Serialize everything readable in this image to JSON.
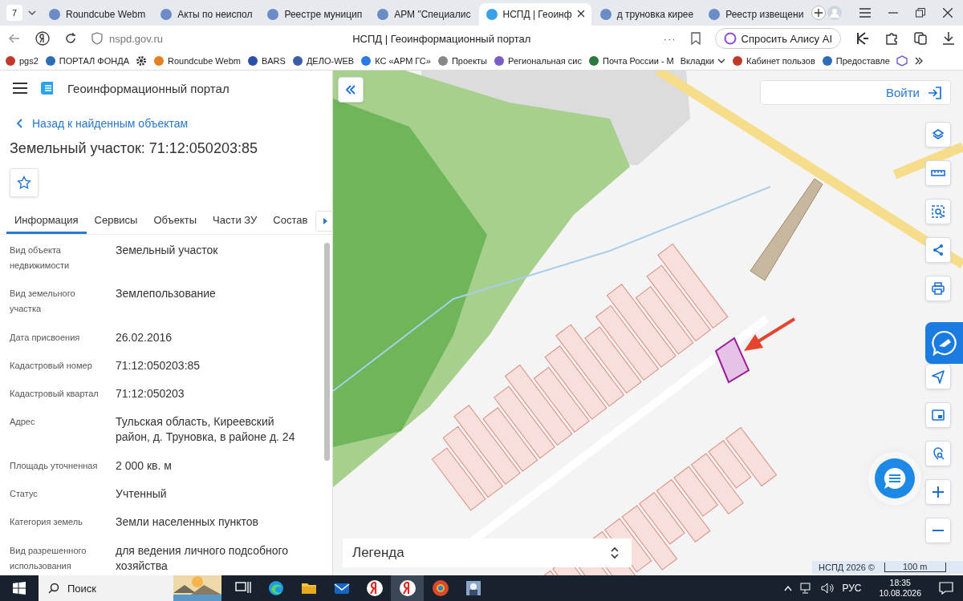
{
  "browser": {
    "tab_count": "7",
    "tabs": [
      {
        "title": "Roundcube Webm",
        "selected": false
      },
      {
        "title": "Акты по неиспол",
        "selected": false
      },
      {
        "title": "Реестре муницип",
        "selected": false
      },
      {
        "title": "АРМ \"Специалис",
        "selected": false
      },
      {
        "title": "НСПД | Геоинф",
        "selected": true
      },
      {
        "title": "д труновка кирее",
        "selected": false
      },
      {
        "title": "Реестр извещени",
        "selected": false
      }
    ],
    "url": "nspd.gov.ru",
    "page_title": "НСПД | Геоинформационный портал",
    "menu_dots": "···",
    "alice_button": "Спросить Алису AI",
    "bookmarks": [
      {
        "kind": "link",
        "label": "pgs2"
      },
      {
        "kind": "link",
        "label": "ПОРТАЛ ФОНДА"
      },
      {
        "kind": "settings"
      },
      {
        "kind": "link",
        "label": "Roundcube Webm"
      },
      {
        "kind": "link",
        "label": "BARS"
      },
      {
        "kind": "link",
        "label": "ДЕЛО-WEB"
      },
      {
        "kind": "link",
        "label": "КС «АРМ ГС»"
      },
      {
        "kind": "link",
        "label": "Проекты"
      },
      {
        "kind": "link",
        "label": "Региональная сис"
      },
      {
        "kind": "link",
        "label": "Почта России - М"
      },
      {
        "kind": "folder",
        "label": "Вкладки"
      },
      {
        "kind": "link",
        "label": "Кабинет пользов"
      },
      {
        "kind": "link",
        "label": "Предоставле"
      },
      {
        "kind": "cube"
      }
    ]
  },
  "panel": {
    "portal_title": "Геоинформационный портал",
    "back_link": "Назад к найденным объектам",
    "object_title": "Земельный участок: 71:12:050203:85",
    "tabs": [
      {
        "label": "Информация",
        "selected": true
      },
      {
        "label": "Сервисы",
        "selected": false
      },
      {
        "label": "Объекты",
        "selected": false
      },
      {
        "label": "Части ЗУ",
        "selected": false
      },
      {
        "label": "Состав",
        "selected": false
      }
    ],
    "fields": [
      {
        "label": "Вид объекта недвижимости",
        "value": "Земельный участок"
      },
      {
        "label": "Вид земельного участка",
        "value": "Землепользование"
      },
      {
        "label": "Дата присвоения",
        "value": "26.02.2016"
      },
      {
        "label": "Кадастровый номер",
        "value": "71:12:050203:85"
      },
      {
        "label": "Кадастровый квартал",
        "value": "71:12:050203"
      },
      {
        "label": "Адрес",
        "value": "Тульская область, Киреевский район, д. Труновка, в районе д. 24"
      },
      {
        "label": "Площадь уточненная",
        "value": "2 000 кв. м"
      },
      {
        "label": "Статус",
        "value": "Учтенный"
      },
      {
        "label": "Категория земель",
        "value": "Земли населенных пунктов"
      },
      {
        "label": "Вид разрешенного использования",
        "value": "для ведения личного подсобного хозяйства"
      }
    ]
  },
  "map": {
    "login_button": "Войти",
    "legend": "Легенда",
    "attribution": "НСПД 2026 ©",
    "scale": "100 m"
  },
  "taskbar": {
    "search_placeholder": "Поиск",
    "apps": [
      {
        "kind": "taskview",
        "active": false
      },
      {
        "kind": "edge",
        "active": false
      },
      {
        "kind": "folder",
        "active": false
      },
      {
        "kind": "mail",
        "active": false
      },
      {
        "kind": "yandex",
        "active": false
      },
      {
        "kind": "yandex",
        "active": true
      },
      {
        "kind": "browser",
        "active": false
      },
      {
        "kind": "app",
        "active": false
      }
    ],
    "language": "РУС",
    "time": "18:35",
    "date": "10.08.2026"
  }
}
